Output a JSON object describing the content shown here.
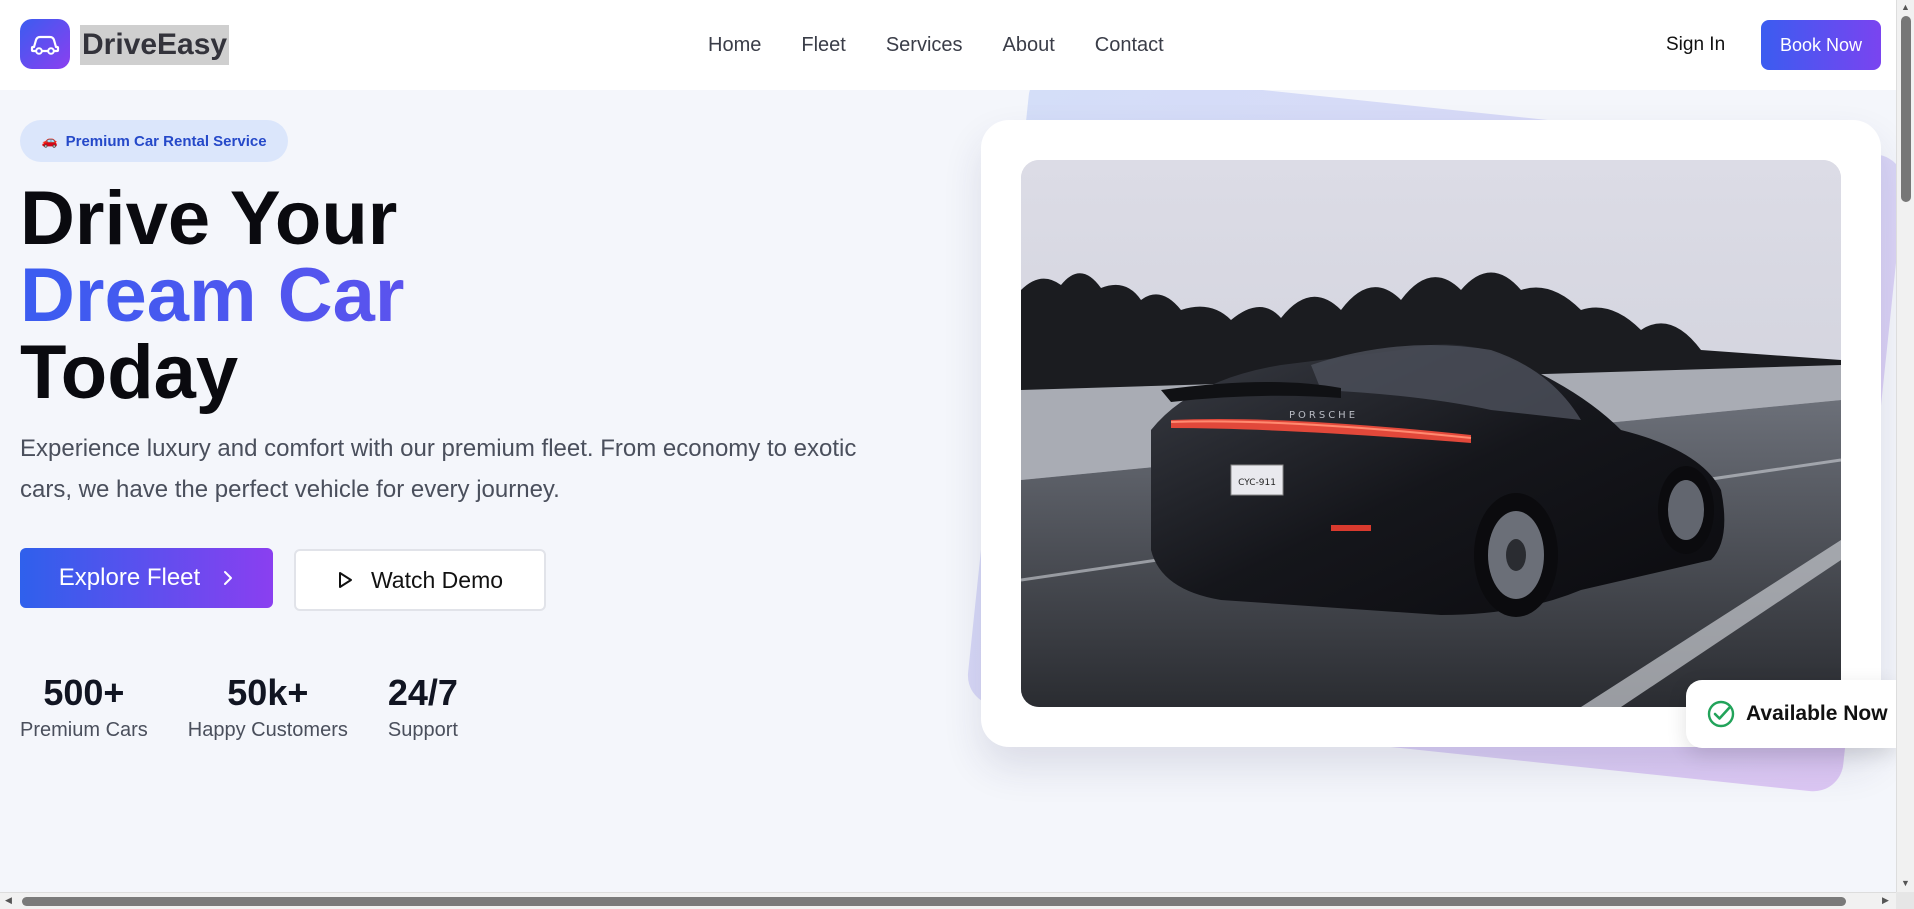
{
  "header": {
    "brand": "DriveEasy",
    "logo_icon": "car-icon",
    "nav": [
      "Home",
      "Fleet",
      "Services",
      "About",
      "Contact"
    ],
    "sign_in": "Sign In",
    "book_now": "Book Now"
  },
  "hero": {
    "badge": "Premium Car Rental Service",
    "badge_icon": "🚗",
    "title_line1": "Drive Your",
    "title_line2": "Dream Car",
    "title_line3": "Today",
    "description": "Experience luxury and comfort with our premium fleet. From economy to exotic cars, we have the perfect vehicle for every journey.",
    "primary_cta": "Explore Fleet",
    "secondary_cta": "Watch Demo",
    "stats": [
      {
        "value": "500+",
        "label": "Premium Cars"
      },
      {
        "value": "50k+",
        "label": "Happy Customers"
      },
      {
        "value": "24/7",
        "label": "Support"
      }
    ],
    "availability": "Available Now",
    "plate_text": "CYC-911",
    "car_badge": "PORSCHE"
  },
  "colors": {
    "accent_start": "#3b5cf0",
    "accent_end": "#8b3ff0",
    "success": "#22a35a"
  }
}
